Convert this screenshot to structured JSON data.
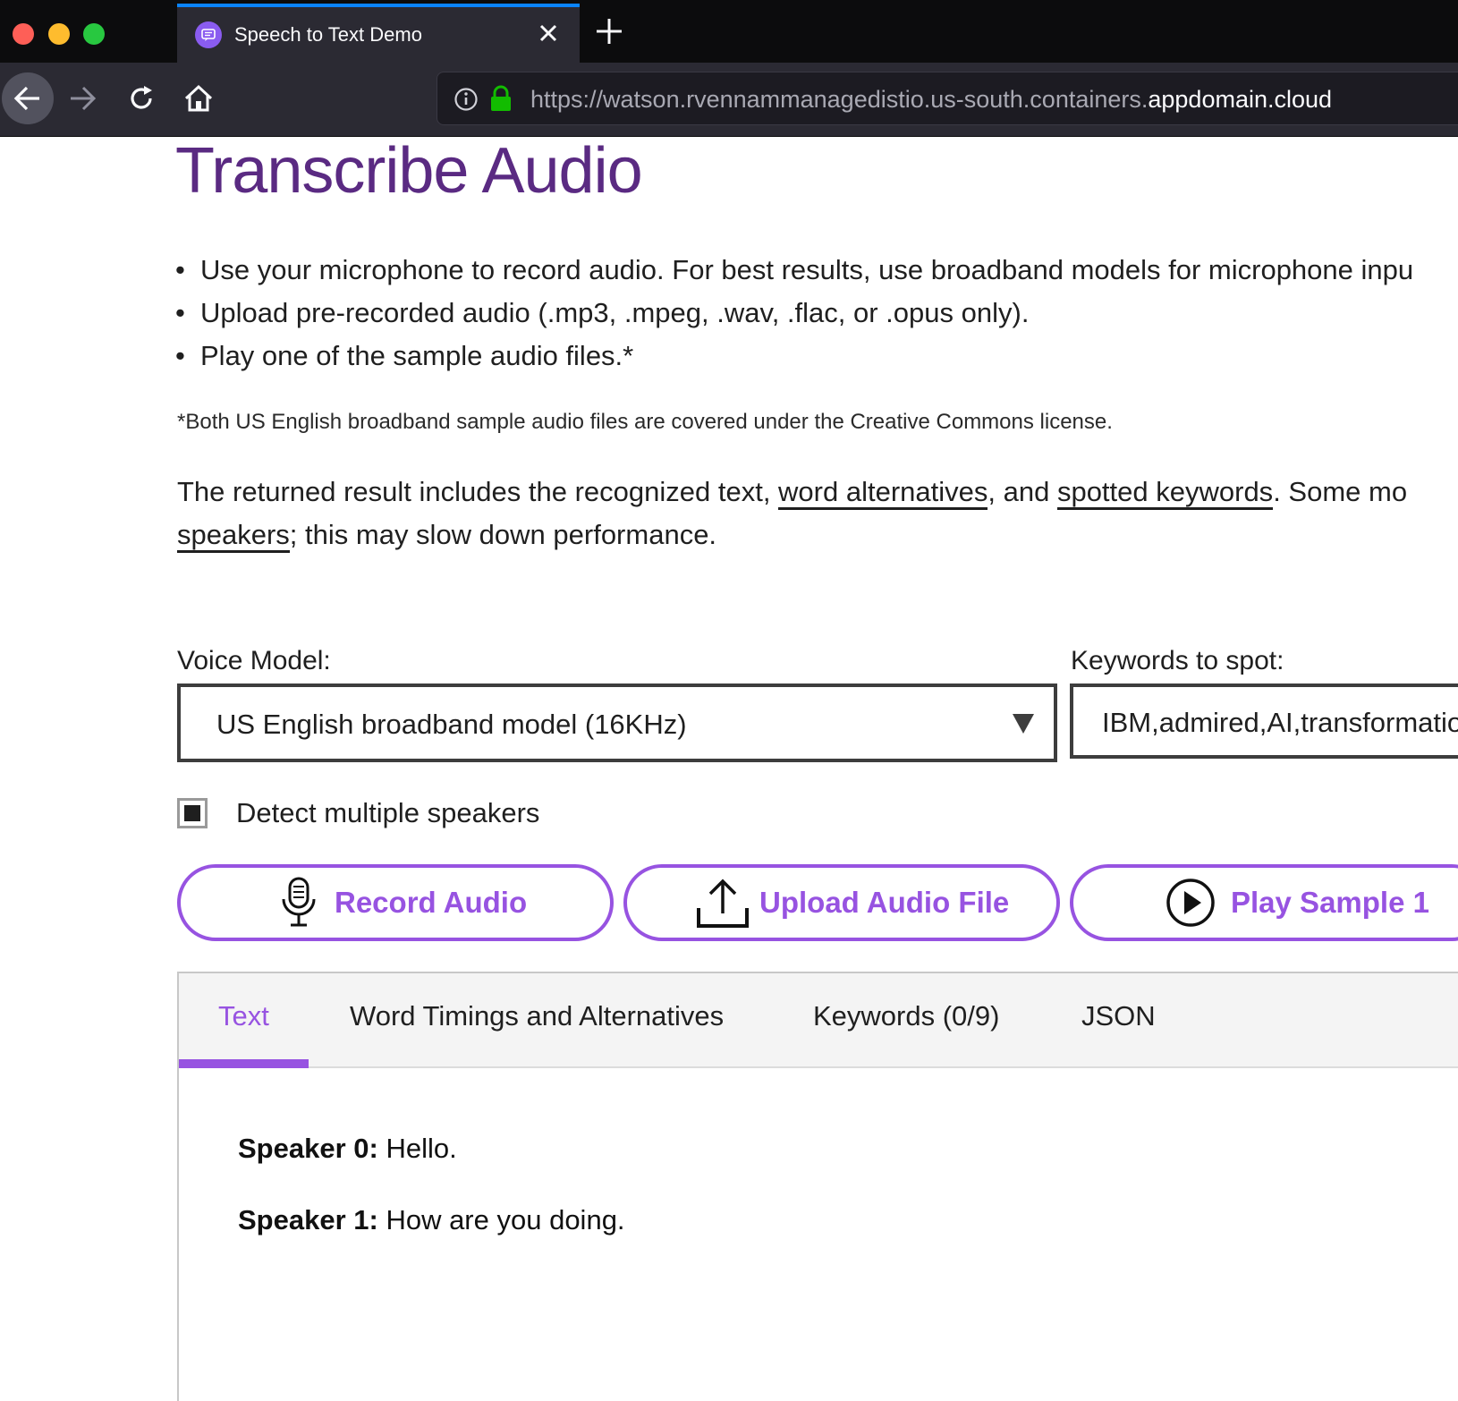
{
  "browser": {
    "tab_title": "Speech to Text Demo",
    "url_prefix": "https://watson.rvennammanagedistio.us-south.containers.",
    "url_domain": "appdomain.cloud"
  },
  "page": {
    "title": "Transcribe Audio",
    "bullets": [
      "Use your microphone to record audio. For best results, use broadband models for microphone inpu",
      "Upload pre-recorded audio (.mp3, .mpeg, .wav, .flac, or .opus only).",
      "Play one of the sample audio files.*"
    ],
    "footnote": "*Both US English broadband sample audio files are covered under the Creative Commons license.",
    "result_desc": {
      "line1_start": "The returned result includes the recognized text, ",
      "link_word_alternatives": "word alternatives",
      "line1_mid": ", and ",
      "link_spotted_keywords": "spotted keywords",
      "line1_end": ". Some mo",
      "link_speakers": "speakers",
      "line2_end": "; this may slow down performance."
    }
  },
  "form": {
    "voice_model_label": "Voice Model:",
    "voice_model_value": "US English broadband model (16KHz)",
    "keywords_label": "Keywords to spot:",
    "keywords_value": "IBM,admired,AI,transformatio",
    "detect_speakers_label": "Detect multiple speakers",
    "detect_speakers_checked": true
  },
  "actions": {
    "record_label": "Record Audio",
    "upload_label": "Upload Audio File",
    "sample_label": "Play Sample 1"
  },
  "output": {
    "tabs": [
      "Text",
      "Word Timings and Alternatives",
      "Keywords (0/9)",
      "JSON"
    ],
    "active_tab": "Text",
    "transcript": [
      {
        "speaker": "Speaker 0:",
        "text": " Hello."
      },
      {
        "speaker": "Speaker 1:",
        "text": " How are you doing."
      }
    ]
  },
  "colors": {
    "accent": "#9753e1",
    "title": "#5a2a82",
    "chrome_dark": "#0c0c0d",
    "chrome_toolbar": "#2b2a33",
    "tab_active_indicator": "#0a84ff",
    "lock_green": "#2ac3a2"
  }
}
